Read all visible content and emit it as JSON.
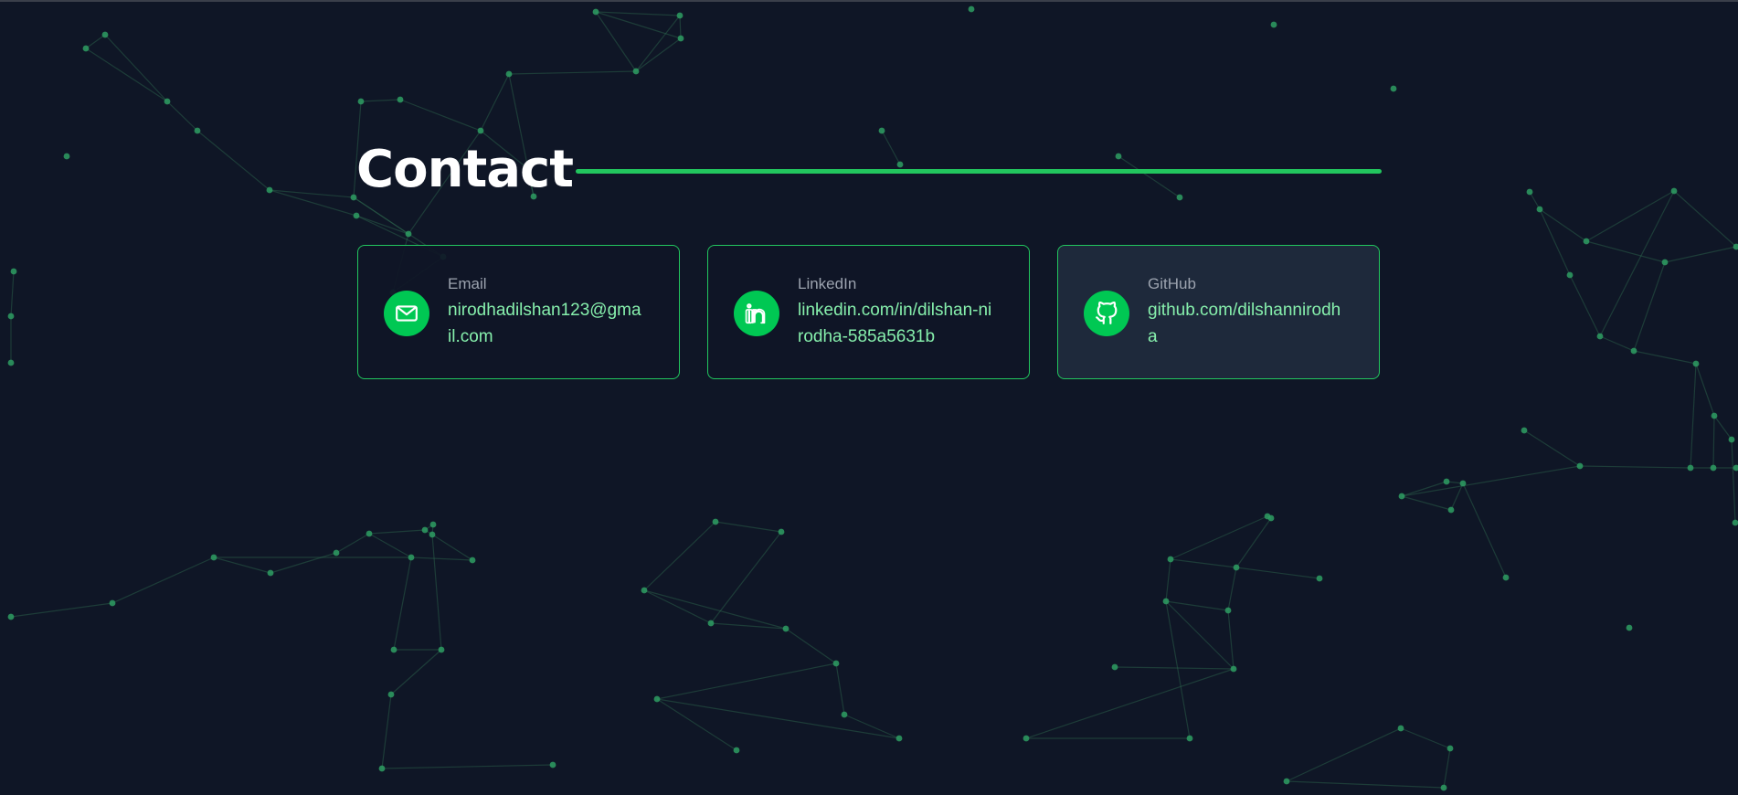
{
  "section": {
    "title": "Contact"
  },
  "contacts": [
    {
      "label": "Email",
      "value": "nirodhadilshan123@gmail.com",
      "icon": "mail-icon"
    },
    {
      "label": "LinkedIn",
      "value": "linkedin.com/in/dilshan-nirodha-585a5631b",
      "icon": "linkedin-icon"
    },
    {
      "label": "GitHub",
      "value": "github.com/dilshannirodha",
      "icon": "github-icon"
    }
  ],
  "colors": {
    "background": "#0f1626",
    "accent": "#22c55e",
    "icon_bg": "#00c853",
    "link_text": "#86efac",
    "label_text": "#9ca3af",
    "card_hover": "#1e293b"
  }
}
